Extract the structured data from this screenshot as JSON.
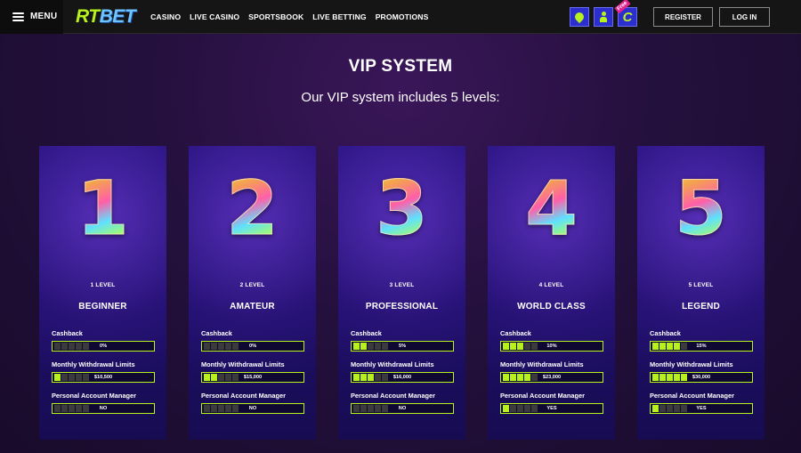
{
  "header": {
    "menu_label": "MENU",
    "logo_rt": "RT",
    "logo_bet": "BET",
    "nav": [
      "CASINO",
      "LIVE CASINO",
      "SPORTSBOOK",
      "LIVE BETTING",
      "PROMOTIONS"
    ],
    "free_tag": "Free",
    "register_label": "REGISTER",
    "login_label": "LOG IN"
  },
  "page": {
    "title": "VIP SYSTEM",
    "subtitle": "Our VIP system includes 5 levels:"
  },
  "labels": {
    "cashback": "Cashback",
    "withdrawal": "Monthly Withdrawal Limits",
    "manager": "Personal Account Manager"
  },
  "colors": {
    "accent": "#b8f21d",
    "card_bg": "#1d0f66",
    "icon_bg": "#2c2fcd"
  },
  "levels": [
    {
      "digit": "1",
      "level": "1 LEVEL",
      "name": "BEGINNER",
      "cashback": "0%",
      "cashback_segments": 0,
      "withdrawal": "$10,500",
      "withdrawal_segments": 1,
      "manager": "NO",
      "manager_segments": 0
    },
    {
      "digit": "2",
      "level": "2 LEVEL",
      "name": "AMATEUR",
      "cashback": "0%",
      "cashback_segments": 0,
      "withdrawal": "$15,000",
      "withdrawal_segments": 2,
      "manager": "NO",
      "manager_segments": 0
    },
    {
      "digit": "3",
      "level": "3 LEVEL",
      "name": "PROFESSIONAL",
      "cashback": "5%",
      "cashback_segments": 2,
      "withdrawal": "$16,000",
      "withdrawal_segments": 3,
      "manager": "NO",
      "manager_segments": 0
    },
    {
      "digit": "4",
      "level": "4 LEVEL",
      "name": "WORLD CLASS",
      "cashback": "10%",
      "cashback_segments": 3,
      "withdrawal": "$23,000",
      "withdrawal_segments": 4,
      "manager": "YES",
      "manager_segments": 1
    },
    {
      "digit": "5",
      "level": "5 LEVEL",
      "name": "LEGEND",
      "cashback": "15%",
      "cashback_segments": 4,
      "withdrawal": "$30,000",
      "withdrawal_segments": 5,
      "manager": "YES",
      "manager_segments": 1
    }
  ]
}
